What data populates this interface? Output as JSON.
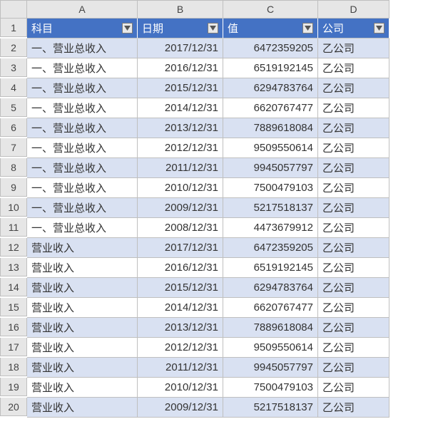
{
  "columns": [
    "A",
    "B",
    "C",
    "D"
  ],
  "row_numbers": [
    1,
    2,
    3,
    4,
    5,
    6,
    7,
    8,
    9,
    10,
    11,
    12,
    13,
    14,
    15,
    16,
    17,
    18,
    19,
    20
  ],
  "headers": {
    "subject": "科目",
    "date": "日期",
    "value": "值",
    "company": "公司"
  },
  "rows": [
    {
      "subject": "一、营业总收入",
      "date": "2017/12/31",
      "value": "6472359205",
      "company": "乙公司"
    },
    {
      "subject": "一、营业总收入",
      "date": "2016/12/31",
      "value": "6519192145",
      "company": "乙公司"
    },
    {
      "subject": "一、营业总收入",
      "date": "2015/12/31",
      "value": "6294783764",
      "company": "乙公司"
    },
    {
      "subject": "一、营业总收入",
      "date": "2014/12/31",
      "value": "6620767477",
      "company": "乙公司"
    },
    {
      "subject": "一、营业总收入",
      "date": "2013/12/31",
      "value": "7889618084",
      "company": "乙公司"
    },
    {
      "subject": "一、营业总收入",
      "date": "2012/12/31",
      "value": "9509550614",
      "company": "乙公司"
    },
    {
      "subject": "一、营业总收入",
      "date": "2011/12/31",
      "value": "9945057797",
      "company": "乙公司"
    },
    {
      "subject": "一、营业总收入",
      "date": "2010/12/31",
      "value": "7500479103",
      "company": "乙公司"
    },
    {
      "subject": "一、营业总收入",
      "date": "2009/12/31",
      "value": "5217518137",
      "company": "乙公司"
    },
    {
      "subject": "一、营业总收入",
      "date": "2008/12/31",
      "value": "4473679912",
      "company": "乙公司"
    },
    {
      "subject": "营业收入",
      "date": "2017/12/31",
      "value": "6472359205",
      "company": "乙公司"
    },
    {
      "subject": "营业收入",
      "date": "2016/12/31",
      "value": "6519192145",
      "company": "乙公司"
    },
    {
      "subject": "营业收入",
      "date": "2015/12/31",
      "value": "6294783764",
      "company": "乙公司"
    },
    {
      "subject": "营业收入",
      "date": "2014/12/31",
      "value": "6620767477",
      "company": "乙公司"
    },
    {
      "subject": "营业收入",
      "date": "2013/12/31",
      "value": "7889618084",
      "company": "乙公司"
    },
    {
      "subject": "营业收入",
      "date": "2012/12/31",
      "value": "9509550614",
      "company": "乙公司"
    },
    {
      "subject": "营业收入",
      "date": "2011/12/31",
      "value": "9945057797",
      "company": "乙公司"
    },
    {
      "subject": "营业收入",
      "date": "2010/12/31",
      "value": "7500479103",
      "company": "乙公司"
    },
    {
      "subject": "营业收入",
      "date": "2009/12/31",
      "value": "5217518137",
      "company": "乙公司"
    }
  ]
}
